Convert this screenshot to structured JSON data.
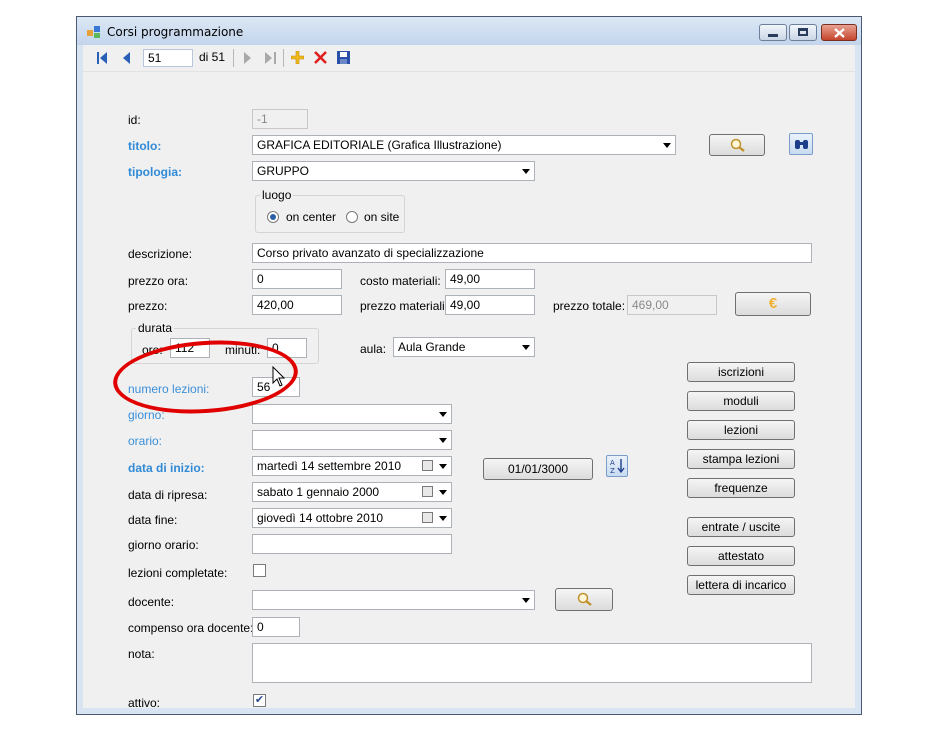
{
  "window": {
    "title": "Corsi programmazione"
  },
  "toolbar": {
    "position": "51",
    "of_label": "di 51"
  },
  "form": {
    "id_label": "id:",
    "id_value": "-1",
    "titolo_label": "titolo:",
    "titolo_value": "GRAFICA EDITORIALE (Grafica Illustrazione)",
    "tipologia_label": "tipologia:",
    "tipologia_value": "GRUPPO",
    "luogo_legend": "luogo",
    "on_center": "on center",
    "on_site": "on site",
    "descrizione_label": "descrizione:",
    "descrizione_value": "Corso privato avanzato di specializzazione",
    "prezzo_ora_label": "prezzo ora:",
    "prezzo_ora_value": "0",
    "costo_materiali_label": "costo materiali:",
    "costo_materiali_value": "49,00",
    "prezzo_label": "prezzo:",
    "prezzo_value": "420,00",
    "prezzo_materiali_label": "prezzo materiali:",
    "prezzo_materiali_value": "49,00",
    "prezzo_totale_label": "prezzo totale:",
    "prezzo_totale_value": "469,00",
    "durata_legend": "durata",
    "ore_label": "ore:",
    "ore_value": "112",
    "minuti_label": "minuti:",
    "minuti_value": "0",
    "aula_label": "aula:",
    "aula_value": "Aula Grande",
    "numero_lezioni_label": "numero lezioni:",
    "numero_lezioni_value": "56",
    "giorno_label": "giorno:",
    "orario_label": "orario:",
    "data_inizio_label": "data di inizio:",
    "data_inizio_value": "martedì   14 settembre 2010",
    "data_ripresa_label": "data di ripresa:",
    "data_ripresa_value": "sabato     1  gennaio  2000",
    "data_fine_label": "data fine:",
    "data_fine_value": "giovedì   14   ottobre   2010",
    "date_button": "01/01/3000",
    "giorno_orario_label": "giorno orario:",
    "lezioni_completate_label": "lezioni completate:",
    "docente_label": "docente:",
    "compenso_label": "compenso ora docente:",
    "compenso_value": "0",
    "nota_label": "nota:",
    "attivo_label": "attivo:"
  },
  "side_buttons": {
    "iscrizioni": "iscrizioni",
    "moduli": "moduli",
    "lezioni": "lezioni",
    "stampa_lezioni": "stampa lezioni",
    "frequenze": "frequenze",
    "entrate_uscite": "entrate / uscite",
    "attestato": "attestato",
    "lettera": "lettera di incarico"
  },
  "icons": [
    "app-icon",
    "first-record-icon",
    "prev-record-icon",
    "next-record-icon",
    "last-record-icon",
    "add-icon",
    "delete-icon",
    "save-icon",
    "search-icon",
    "binoculars-icon",
    "euro-icon",
    "sort-az-icon",
    "calendar-icon",
    "mouse-cursor-icon"
  ]
}
